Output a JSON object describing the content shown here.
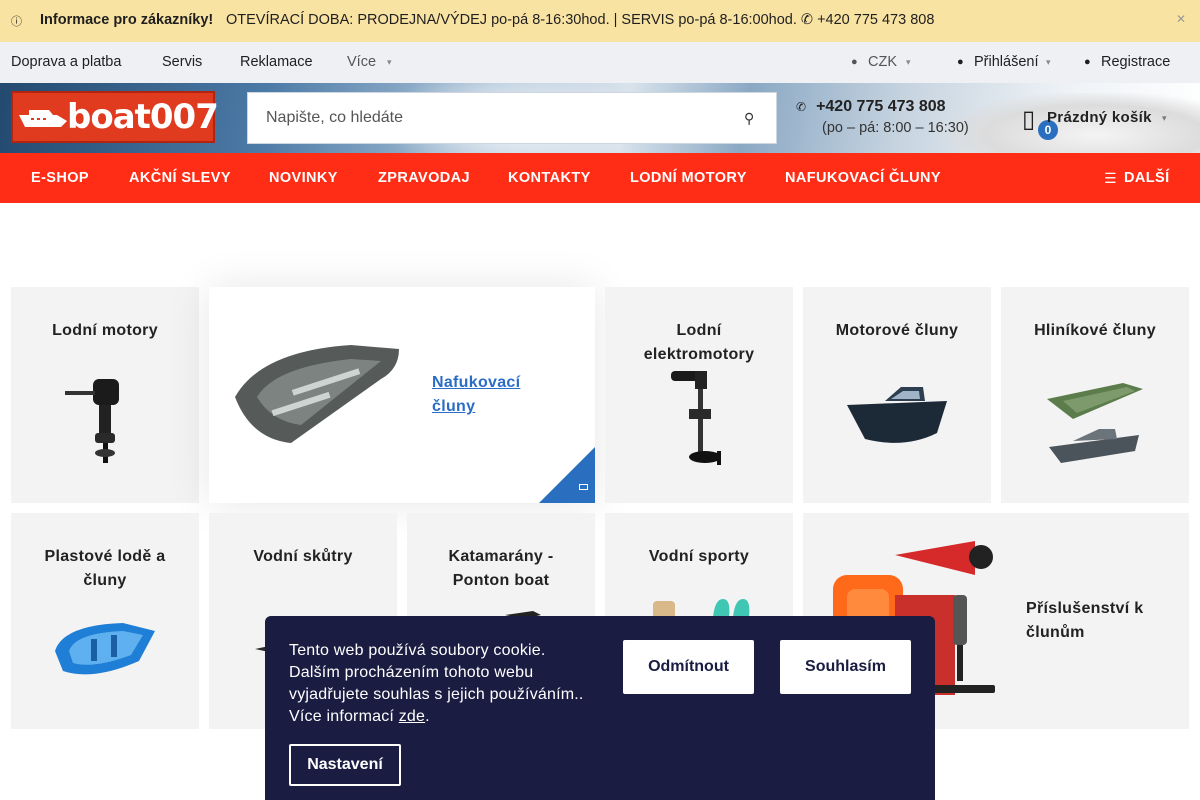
{
  "infobar": {
    "icon": "info-icon",
    "strong": "Informace pro zákazníky!",
    "text": "OTEVÍRACÍ DOBA: PRODEJNA/VÝDEJ po-pá 8-16:30hod. | SERVIS po-pá 8-16:00hod. ✆ +420 775 473 808",
    "close_icon": "close-icon"
  },
  "topnav": {
    "links": [
      "Doprava a platba",
      "Servis",
      "Reklamace"
    ],
    "more": "Více",
    "currency": "CZK",
    "login": "Přihlášení",
    "register": "Registrace"
  },
  "header": {
    "logo_text": "boat007",
    "search_placeholder": "Napište, co hledáte",
    "phone": "+420 775 473 808",
    "hours": "(po – pá: 8:00 – 16:30)",
    "cart_count": "0",
    "cart_label": "Prázdný košík"
  },
  "mainnav": {
    "items": [
      "E-SHOP",
      "AKČNÍ SLEVY",
      "NOVINKY",
      "ZPRAVODAJ",
      "KONTAKTY",
      "LODNÍ MOTORY",
      "NAFUKOVACÍ ČLUNY"
    ],
    "more": "DALŠÍ"
  },
  "categories": {
    "lodni_motory": "Lodní motory",
    "nafukovaci_cluny": "Nafukovací čluny",
    "elektromotory": "Lodní elektromotory",
    "motorove_cluny": "Motorové čluny",
    "hlinikove_cluny": "Hliníkové čluny",
    "plastove_lode": "Plastové lodě a čluny",
    "vodni_skutry": "Vodní skůtry",
    "katamarany": "Katamarány - Ponton boat",
    "vodni_sporty": "Vodní sporty",
    "prislusenstvi": "Příslušenství k člunům"
  },
  "cookie": {
    "text": "Tento web používá soubory cookie. Dalším procházením tohoto webu vyjadřujete souhlas s jejich používáním.. Více informací ",
    "link": "zde",
    "after_link": ".",
    "reject": "Odmítnout",
    "accept": "Souhlasím",
    "settings": "Nastavení"
  },
  "colors": {
    "accent_red": "#ff2d16",
    "info_yellow": "#f9e3a3",
    "link_blue": "#2b6cc7",
    "cookie_bg": "#1a1c42"
  }
}
